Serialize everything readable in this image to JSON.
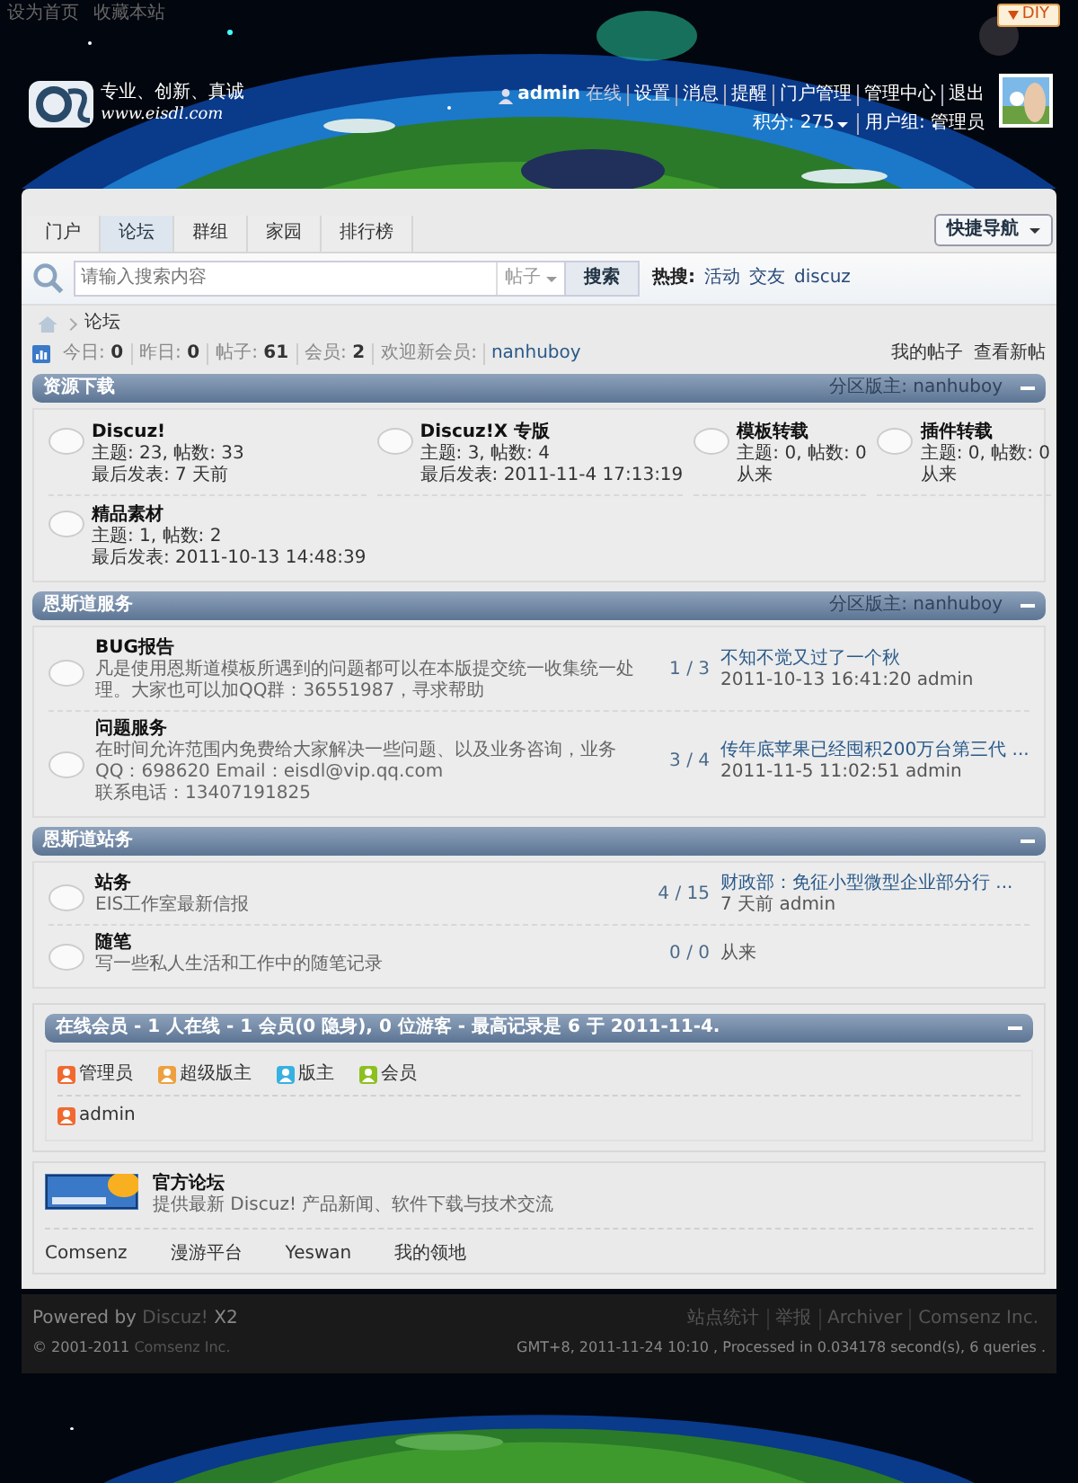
{
  "topbar": {
    "links": [
      "设为首页",
      "收藏本站"
    ],
    "diy": "DIY"
  },
  "logo": {
    "slogan": "专业、创新、真诚",
    "url": "www.eisdl.com"
  },
  "user": {
    "name": "admin",
    "status": "在线",
    "links": [
      "设置",
      "消息",
      "提醒",
      "门户管理",
      "管理中心",
      "退出"
    ],
    "points": "积分: 275",
    "group": "用户组: 管理员"
  },
  "nav": {
    "tabs": [
      {
        "label": "门户",
        "selected": false
      },
      {
        "label": "论坛",
        "selected": true
      },
      {
        "label": "群组",
        "selected": false
      },
      {
        "label": "家园",
        "selected": false
      },
      {
        "label": "排行榜",
        "selected": false
      }
    ],
    "quick_nav": "快捷导航"
  },
  "search": {
    "placeholder": "请输入搜索内容",
    "scope": "帖子",
    "button": "搜索",
    "hot_label": "热搜:",
    "hot": [
      "活动",
      "交友",
      "discuz"
    ]
  },
  "breadcrumb": "论坛",
  "stats": {
    "items": [
      {
        "label": "今日:",
        "value": "0"
      },
      {
        "label": "昨日:",
        "value": "0"
      },
      {
        "label": "帖子:",
        "value": "61"
      },
      {
        "label": "会员:",
        "value": "2"
      }
    ],
    "welcome": "欢迎新会员:",
    "new_member": "nanhuboy",
    "links": [
      "我的帖子",
      "查看新帖"
    ]
  },
  "categories": [
    {
      "title": "资源下载",
      "moderator_label": "分区版主:",
      "moderator": "nanhuboy",
      "kind": "grid",
      "forums": [
        {
          "name": "Discuz!",
          "stats": "主题: 23, 帖数: 33",
          "last": "最后发表: 7 天前"
        },
        {
          "name": "Discuz!X 专版",
          "stats": "主题: 3, 帖数: 4",
          "last": "最后发表: 2011-11-4 17:13:19"
        },
        {
          "name": "模板转载",
          "stats": "主题: 0, 帖数: 0",
          "last": "从来"
        },
        {
          "name": "插件转载",
          "stats": "主题: 0, 帖数: 0",
          "last": "从来"
        },
        {
          "name": "精品素材",
          "stats": "主题: 1, 帖数: 2",
          "last": "最后发表: 2011-10-13 14:48:39"
        }
      ]
    },
    {
      "title": "恩斯道服务",
      "moderator_label": "分区版主:",
      "moderator": "nanhuboy",
      "kind": "list",
      "forums": [
        {
          "name": "BUG报告",
          "description": "凡是使用恩斯道模板所遇到的问题都可以在本版提交统一收集统一处理。大家也可以加QQ群：36551987，寻求帮助",
          "count": "1 / 3",
          "last_title": "不知不觉又过了一个秋",
          "last_info": "2011-10-13 16:41:20 admin"
        },
        {
          "name": "问题服务",
          "description": "在时间允许范围内免费给大家解决一些问题、以及业务咨询，业务QQ：698620 Email：eisdl@vip.qq.com\n联系电话：13407191825",
          "count": "3 / 4",
          "last_title": "传年底苹果已经囤积200万台第三代 ...",
          "last_info": "2011-11-5 11:02:51 admin"
        }
      ]
    },
    {
      "title": "恩斯道站务",
      "kind": "list",
      "forums": [
        {
          "name": "站务",
          "description": "EIS工作室最新信报",
          "count": "4 / 15",
          "last_title": "财政部：免征小型微型企业部分行 ...",
          "last_info": "7 天前 admin"
        },
        {
          "name": "随笔",
          "description": "写一些私人生活和工作中的随笔记录",
          "count": "0 / 0",
          "last_info": "从来"
        }
      ]
    }
  ],
  "online": {
    "title": "在线会员 - 1 人在线 - 1 会员(0 隐身), 0 位游客 - 最高记录是 6 于 2011-11-4.",
    "legend": [
      {
        "label": "管理员",
        "color": "#f06a30"
      },
      {
        "label": "超级版主",
        "color": "#eea040"
      },
      {
        "label": "版主",
        "color": "#38b0e0"
      },
      {
        "label": "会员",
        "color": "#8cc020"
      }
    ],
    "users": [
      {
        "name": "admin",
        "color": "#f06a30"
      }
    ]
  },
  "links": {
    "featured": {
      "title": "官方论坛",
      "description": "提供最新 Discuz! 产品新闻、软件下载与技术交流"
    },
    "text_links": [
      "Comsenz",
      "漫游平台",
      "Yeswan",
      "我的领地"
    ]
  },
  "footer": {
    "powered": "Powered by",
    "brand": "Discuz!",
    "version": "X2",
    "copyright": "© 2001-2011",
    "company": "Comsenz Inc.",
    "links": [
      "站点统计",
      "举报",
      "Archiver",
      "Comsenz Inc."
    ],
    "info": "GMT+8, 2011-11-24 10:10 , Processed in 0.034178 second(s), 6 queries ."
  }
}
